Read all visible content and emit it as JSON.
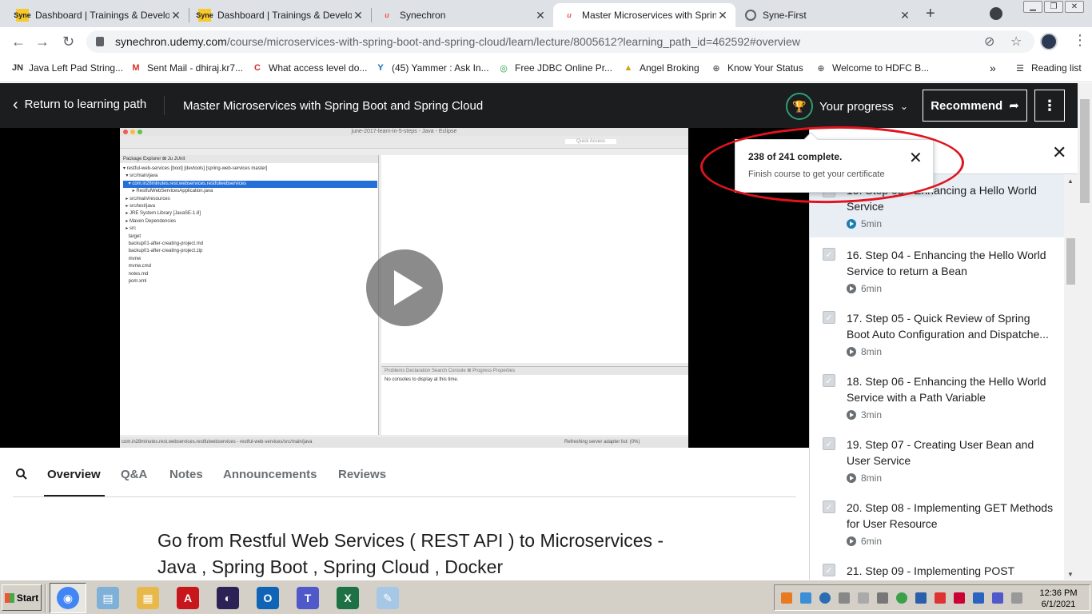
{
  "browser": {
    "tabs": [
      {
        "title": "Dashboard | Trainings & Develop",
        "icon": "syne-icon",
        "fav": "Syne"
      },
      {
        "title": "Dashboard | Trainings & Develop",
        "icon": "syne-icon",
        "fav": "Syne"
      },
      {
        "title": "Synechron",
        "icon": "udemy-icon",
        "fav": "u"
      },
      {
        "title": "Master Microservices with Sprin",
        "icon": "udemy-icon",
        "fav": "u"
      },
      {
        "title": "Syne-First",
        "icon": "globe-icon",
        "fav": ""
      }
    ],
    "close_glyph": "✕",
    "new_tab_glyph": "+",
    "url_host": "synechron.udemy.com",
    "url_path": "/course/microservices-with-spring-boot-and-spring-cloud/learn/lecture/8005612?learning_path_id=462592#overview",
    "bookmarks": [
      {
        "label": "Java Left Pad String...",
        "icon": "jn-icon",
        "glyph": "JN",
        "color": "#333333"
      },
      {
        "label": "Sent Mail - dhiraj.kr7...",
        "icon": "gmail-icon",
        "glyph": "M",
        "color": "#d93025"
      },
      {
        "label": "What access level do...",
        "icon": "c-icon",
        "glyph": "C",
        "color": "#d62828"
      },
      {
        "label": "(45) Yammer : Ask In...",
        "icon": "yammer-icon",
        "glyph": "Y",
        "color": "#106ebe"
      },
      {
        "label": "Free JDBC Online Pr...",
        "icon": "jdbc-icon",
        "glyph": "◎",
        "color": "#2a9d3c"
      },
      {
        "label": "Angel Broking",
        "icon": "angel-icon",
        "glyph": "▲",
        "color": "#d4a017"
      },
      {
        "label": "Know Your Status",
        "icon": "globe-icon",
        "glyph": "⊕",
        "color": "#5f6368"
      },
      {
        "label": "Welcome to HDFC B...",
        "icon": "globe-icon",
        "glyph": "⊕",
        "color": "#5f6368"
      }
    ],
    "bookmarks_overflow": "»",
    "reading_list": "Reading list"
  },
  "header": {
    "back_label": "Return to learning path",
    "course_title": "Master Microservices with Spring Boot and Spring Cloud",
    "progress_label": "Your progress",
    "recommend_label": "Recommend"
  },
  "video": {
    "window_title": "june-2017-learn-in-5-steps - Java - Eclipse",
    "panel_tabs": "Package Explorer  ⊠  Ju JUnit",
    "tree": [
      "▾ restful-web-services [boot] [devtools] [spring-web-services master]",
      "  ▾ src/main/java",
      "    ▾ com.in28minutes.rest.webservices.restfulwebservices",
      "       ▸ RestfulWebServicesApplication.java",
      "  ▸ src/main/resources",
      "  ▸ src/test/java",
      "  ▸ JRE System Library [JavaSE-1.8]",
      "  ▸ Maven Dependencies",
      "  ▸ src",
      "    target",
      "    backup01-after-creating-project.md",
      "    backup01-after-creating-project.zip",
      "    mvnw",
      "    mvnw.cmd",
      "    notes.md",
      "    pom.xml"
    ],
    "console_tabs": "Problems   Declaration   Search   Console ⊠   Progress   Properties",
    "console_text": "No consoles to display at this time.",
    "status_left": "com.in28minutes.rest.webservices.restfulwebservices - restful-web-services/src/main/java",
    "status_right": "Refreshing server adapter list: (0%)",
    "quick_access": "Quick Access"
  },
  "tabs": [
    "Overview",
    "Q&A",
    "Notes",
    "Announcements",
    "Reviews"
  ],
  "overview_title": "Go from Restful Web Services ( REST API ) to Microservices - Java , Spring Boot , Spring Cloud , Docker",
  "popover": {
    "title": "238 of 241 complete.",
    "subtitle": "Finish course to get your certificate"
  },
  "sidebar": {
    "lectures": [
      {
        "title": "15. Step 03 - Enhancing a Hello World",
        "title2": "Service",
        "duration": "5min",
        "current": true
      },
      {
        "title": "16. Step 04 - Enhancing the Hello World",
        "title2": "Service to return a Bean",
        "duration": "6min",
        "current": false
      },
      {
        "title": "17. Step 05 - Quick Review of Spring",
        "title2": "Boot Auto Configuration and Dispatche...",
        "duration": "8min",
        "current": false
      },
      {
        "title": "18. Step 06 - Enhancing the Hello World",
        "title2": "Service with a Path Variable",
        "duration": "3min",
        "current": false
      },
      {
        "title": "19. Step 07 - Creating User Bean and",
        "title2": "User Service",
        "duration": "8min",
        "current": false
      },
      {
        "title": "20. Step 08 - Implementing GET Methods",
        "title2": "for User Resource",
        "duration": "6min",
        "current": false
      },
      {
        "title": "21. Step 09 - Implementing POST",
        "title2": "",
        "duration": "",
        "current": false
      }
    ]
  },
  "taskbar": {
    "start_label": "Start",
    "apps": [
      {
        "name": "chrome-icon",
        "color": "#4285f4",
        "glyph": "◉"
      },
      {
        "name": "notepad-icon",
        "color": "#7fb0d8",
        "glyph": "▤"
      },
      {
        "name": "explorer-icon",
        "color": "#e8b84a",
        "glyph": "▦"
      },
      {
        "name": "acrobat-icon",
        "color": "#c8161d",
        "glyph": "A"
      },
      {
        "name": "eclipse-icon",
        "color": "#2c2255",
        "glyph": "◐"
      },
      {
        "name": "outlook-icon",
        "color": "#0f64b5",
        "glyph": "O"
      },
      {
        "name": "teams-icon",
        "color": "#5059c9",
        "glyph": "T"
      },
      {
        "name": "excel-icon",
        "color": "#1e7145",
        "glyph": "X"
      },
      {
        "name": "paint-icon",
        "color": "#a7c7e7",
        "glyph": "✎"
      }
    ],
    "time": "12:36 PM",
    "date": "6/1/2021"
  },
  "colors": {
    "udemy_dark": "#1c1d1f",
    "progress_ring": "#2f9c74",
    "annotation_red": "#e0141e",
    "selection_blue": "#2470d8"
  }
}
